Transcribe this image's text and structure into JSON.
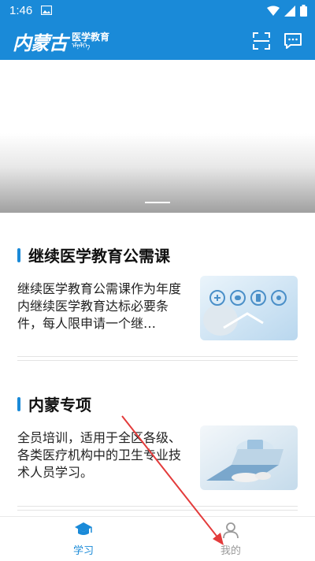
{
  "status_bar": {
    "time": "1:46"
  },
  "header": {
    "logo_script": "内蒙古",
    "logo_text": "医学教育",
    "logo_mongolian": "ᠡᠮᠨᠡᠯᠭᠡ",
    "scan_icon": "scan-icon",
    "message_icon": "message-icon"
  },
  "sections": [
    {
      "title": "继续医学教育公需课",
      "description": "继续医学教育公需课作为年度内继续医学教育达标必要条件，每人限申请一个继…"
    },
    {
      "title": "内蒙专项",
      "description": "全员培训，适用于全区各级、各类医疗机构中的卫生专业技术人员学习。"
    }
  ],
  "tabs": [
    {
      "label": "学习",
      "icon": "graduation-cap-icon",
      "active": true
    },
    {
      "label": "我的",
      "icon": "person-icon",
      "active": false
    }
  ],
  "colors": {
    "primary": "#1a8ad8",
    "tab_inactive": "#999999"
  }
}
